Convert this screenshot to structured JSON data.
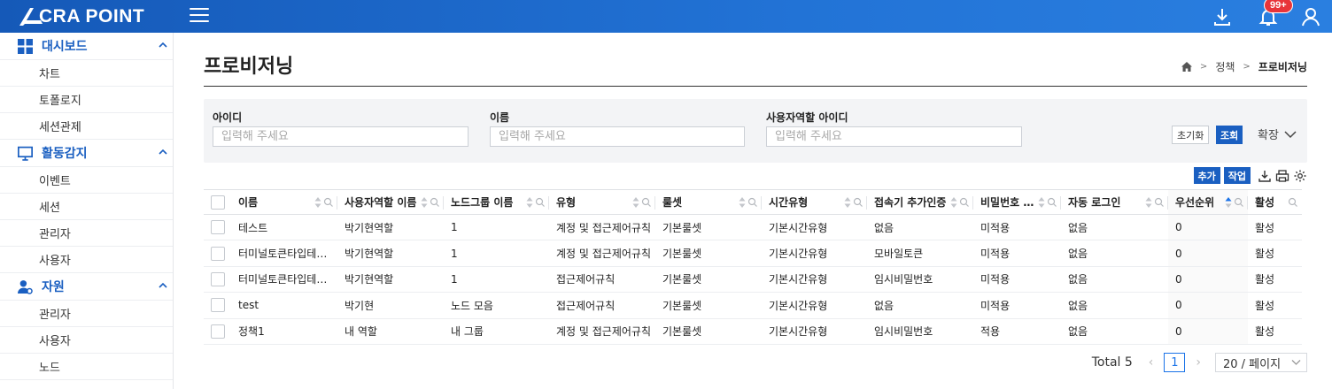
{
  "brand": {
    "logo_text": "CRA POINT",
    "notification_count": "99+"
  },
  "sidebar": {
    "groups": [
      {
        "label": "대시보드",
        "icon": "dashboard-grid-icon",
        "items": [
          "차트",
          "토폴로지",
          "세션관제"
        ]
      },
      {
        "label": "활동감지",
        "icon": "monitor-icon",
        "items": [
          "이벤트",
          "세션",
          "관리자",
          "사용자"
        ]
      },
      {
        "label": "자원",
        "icon": "user-settings-icon",
        "items": [
          "관리자",
          "사용자",
          "노드"
        ]
      }
    ]
  },
  "page": {
    "title": "프로비저닝"
  },
  "breadcrumb": {
    "items": [
      "정책",
      "프로비저닝"
    ]
  },
  "search": {
    "fields": [
      {
        "label": "아이디",
        "placeholder": "입력해 주세요"
      },
      {
        "label": "이름",
        "placeholder": "입력해 주세요"
      },
      {
        "label": "사용자역할 아이디",
        "placeholder": "입력해 주세요"
      }
    ],
    "reset_label": "초기화",
    "search_label": "조회",
    "expand_label": "확장"
  },
  "toolbar": {
    "add_label": "추가",
    "job_label": "작업"
  },
  "table": {
    "columns": [
      "이름",
      "사용자역할 이름",
      "노드그룹 이름",
      "유형",
      "룰셋",
      "시간유형",
      "접속기 추가인증",
      "비밀번호 …",
      "자동 로그인",
      "우선순위",
      "활성"
    ],
    "rows": [
      [
        "테스트",
        "박기현역할",
        "1",
        "계정 및 접근제어규칙",
        "기본룰셋",
        "기본시간유형",
        "없음",
        "미적용",
        "없음",
        "0",
        "활성"
      ],
      [
        "터미널토큰타입테…",
        "박기현역할",
        "1",
        "계정 및 접근제어규칙",
        "기본룰셋",
        "기본시간유형",
        "모바일토큰",
        "미적용",
        "없음",
        "0",
        "활성"
      ],
      [
        "터미널토큰타입테…",
        "박기현역할",
        "1",
        "접근제어규칙",
        "기본룰셋",
        "기본시간유형",
        "임시비밀번호",
        "미적용",
        "없음",
        "0",
        "활성"
      ],
      [
        "test",
        "박기현",
        "노드 모음",
        "접근제어규칙",
        "기본룰셋",
        "기본시간유형",
        "없음",
        "미적용",
        "없음",
        "0",
        "활성"
      ],
      [
        "정책1",
        "내 역할",
        "내 그룹",
        "계정 및 접근제어규칙",
        "기본룰셋",
        "기본시간유형",
        "임시비밀번호",
        "적용",
        "없음",
        "0",
        "활성"
      ]
    ]
  },
  "pagination": {
    "total_label": "Total 5",
    "current_page": "1",
    "page_size_label": "20 / 페이지"
  }
}
